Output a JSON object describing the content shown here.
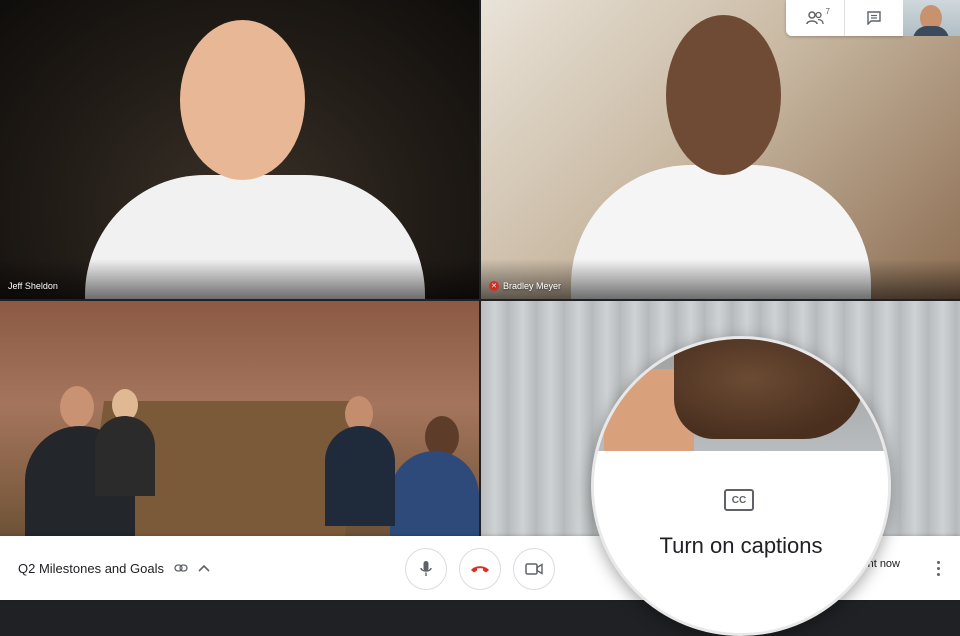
{
  "participants": {
    "tile1": {
      "name": "Jeff Sheldon",
      "muted": false
    },
    "tile2": {
      "name": "Bradley Meyer",
      "muted": true
    }
  },
  "top_controls": {
    "people_count": "7",
    "people_icon": "people-icon",
    "chat_icon": "chat-icon"
  },
  "bottom_bar": {
    "meeting_title": "Q2 Milestones and Goals",
    "present_label": "sent now"
  },
  "captions_callout": {
    "text": "Turn on captions",
    "icon_text": "CC"
  },
  "colors": {
    "hangup_red": "#d93025",
    "text_primary": "#202124",
    "icon_gray": "#5f6368"
  }
}
